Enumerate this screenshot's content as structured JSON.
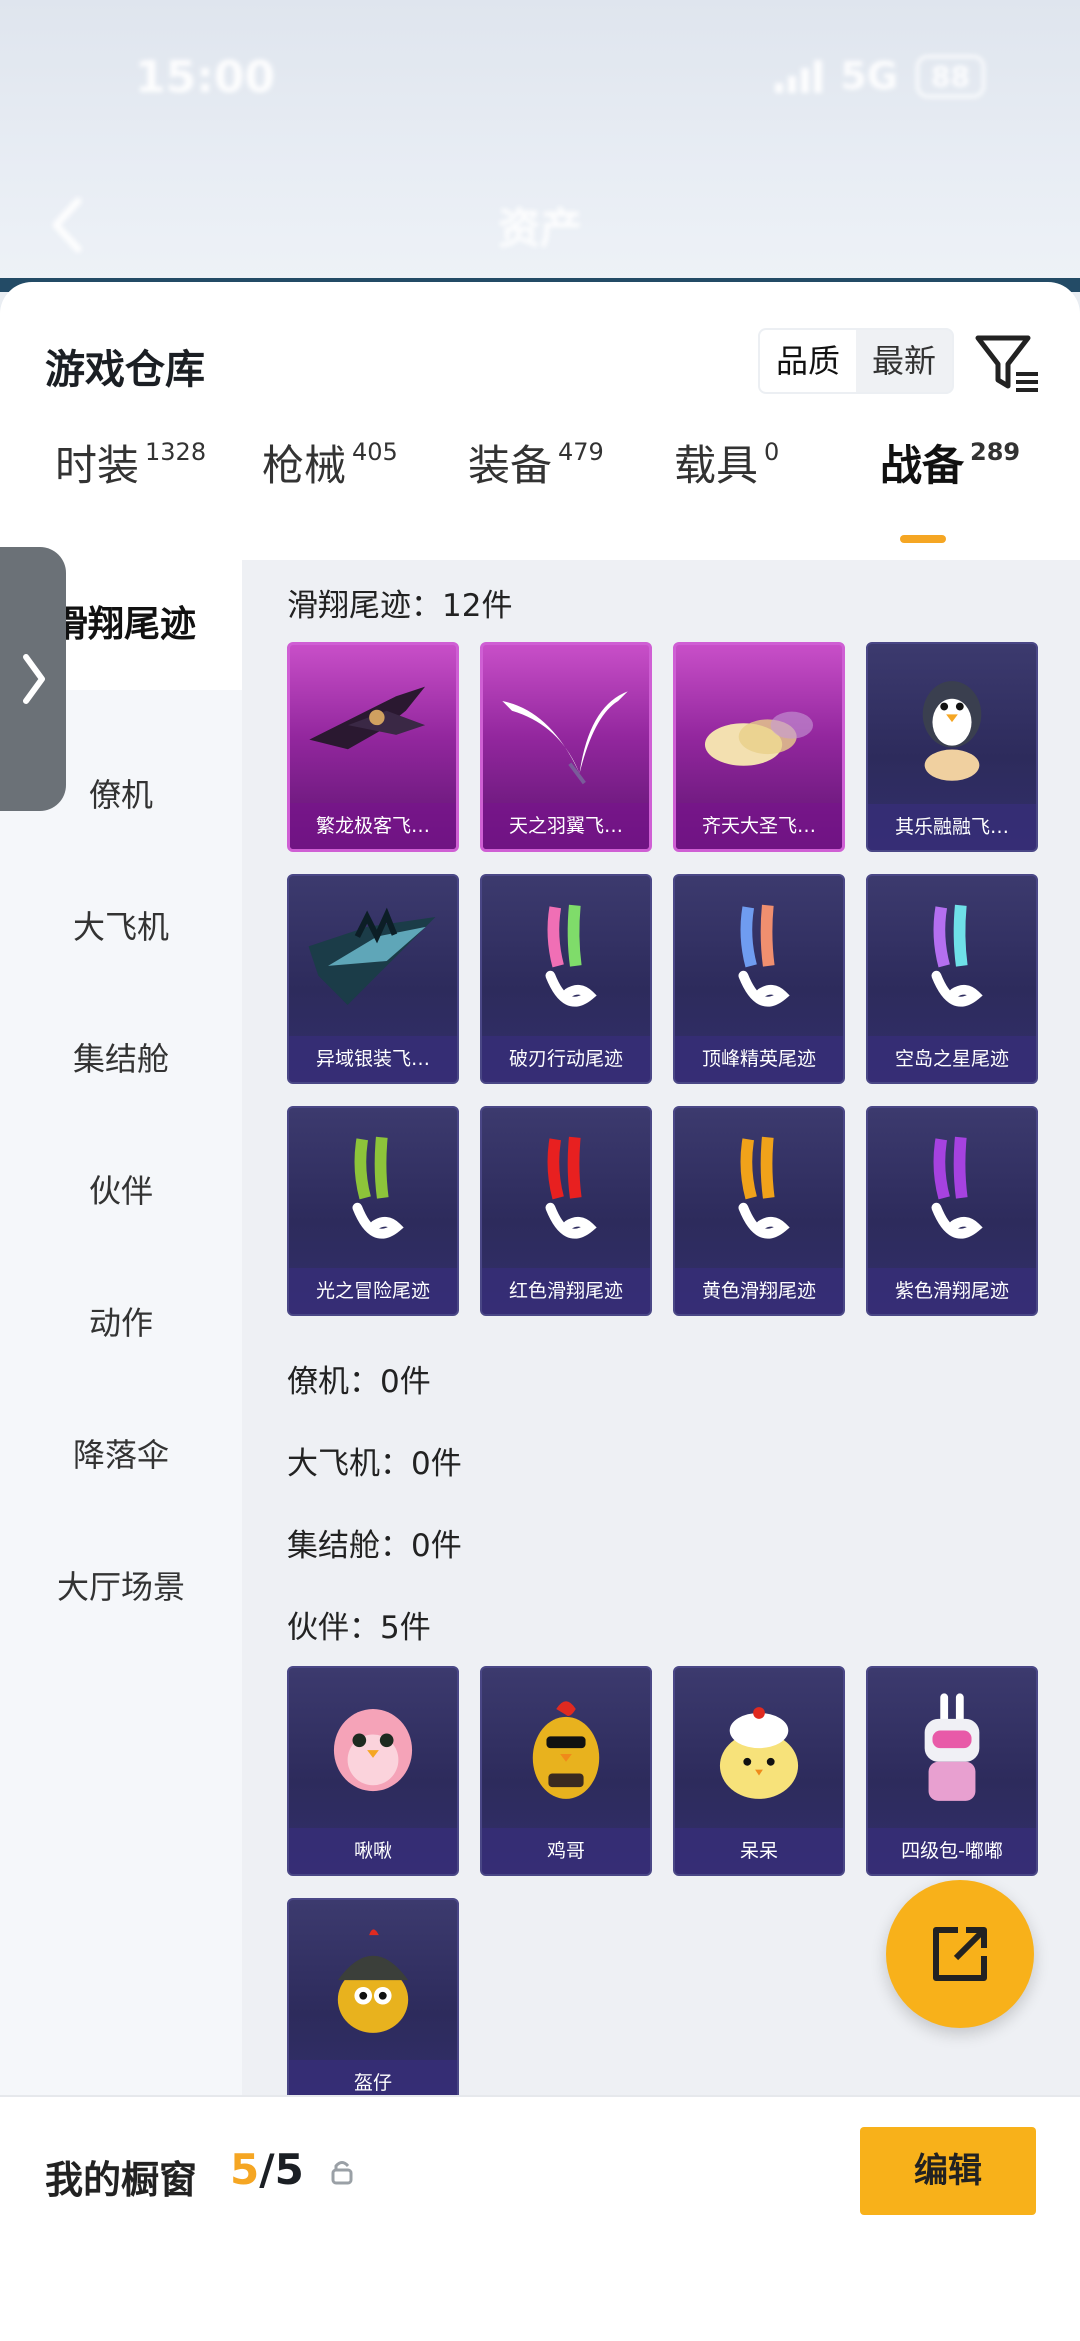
{
  "status_bar": {
    "time": "15:00",
    "network": "5G",
    "battery": "88"
  },
  "header": {
    "title": "资产"
  },
  "sheet": {
    "title": "游戏仓库",
    "sort": {
      "quality": "品质",
      "newest": "最新"
    }
  },
  "tabs": [
    {
      "label": "时装",
      "count": "1328"
    },
    {
      "label": "枪械",
      "count": "405"
    },
    {
      "label": "装备",
      "count": "479"
    },
    {
      "label": "载具",
      "count": "0"
    },
    {
      "label": "战备",
      "count": "289"
    }
  ],
  "sidenav": [
    "滑翔尾迹",
    "僚机",
    "大飞机",
    "集结舱",
    "伙伴",
    "动作",
    "降落伞",
    "大厅场景"
  ],
  "sections": {
    "glide": "滑翔尾迹：12件",
    "wingman": "僚机：0件",
    "plane": "大飞机：0件",
    "pod": "集结舱：0件",
    "partner": "伙伴：5件"
  },
  "glide_items": [
    {
      "name": "繁龙极客飞…",
      "rarity": "purple"
    },
    {
      "name": "天之羽翼飞…",
      "rarity": "purple"
    },
    {
      "name": "齐天大圣飞…",
      "rarity": "purple"
    },
    {
      "name": "其乐融融飞…",
      "rarity": "navy"
    },
    {
      "name": "异域银装飞…",
      "rarity": "navy"
    },
    {
      "name": "破刃行动尾迹",
      "rarity": "navy"
    },
    {
      "name": "顶峰精英尾迹",
      "rarity": "navy"
    },
    {
      "name": "空岛之星尾迹",
      "rarity": "navy"
    },
    {
      "name": "光之冒险尾迹",
      "rarity": "navy"
    },
    {
      "name": "红色滑翔尾迹",
      "rarity": "navy"
    },
    {
      "name": "黄色滑翔尾迹",
      "rarity": "navy"
    },
    {
      "name": "紫色滑翔尾迹",
      "rarity": "navy"
    }
  ],
  "partner_items": [
    {
      "name": "啾啾"
    },
    {
      "name": "鸡哥"
    },
    {
      "name": "呆呆"
    },
    {
      "name": "四级包-嘟嘟"
    },
    {
      "name": "盔仔"
    }
  ],
  "bottom": {
    "title": "我的橱窗",
    "current": "5",
    "total": "/5",
    "edit": "编辑"
  },
  "colors": {
    "accent": "#f8b11a",
    "purple_rarity": "#a030b0",
    "navy_card": "#2f2d60"
  }
}
